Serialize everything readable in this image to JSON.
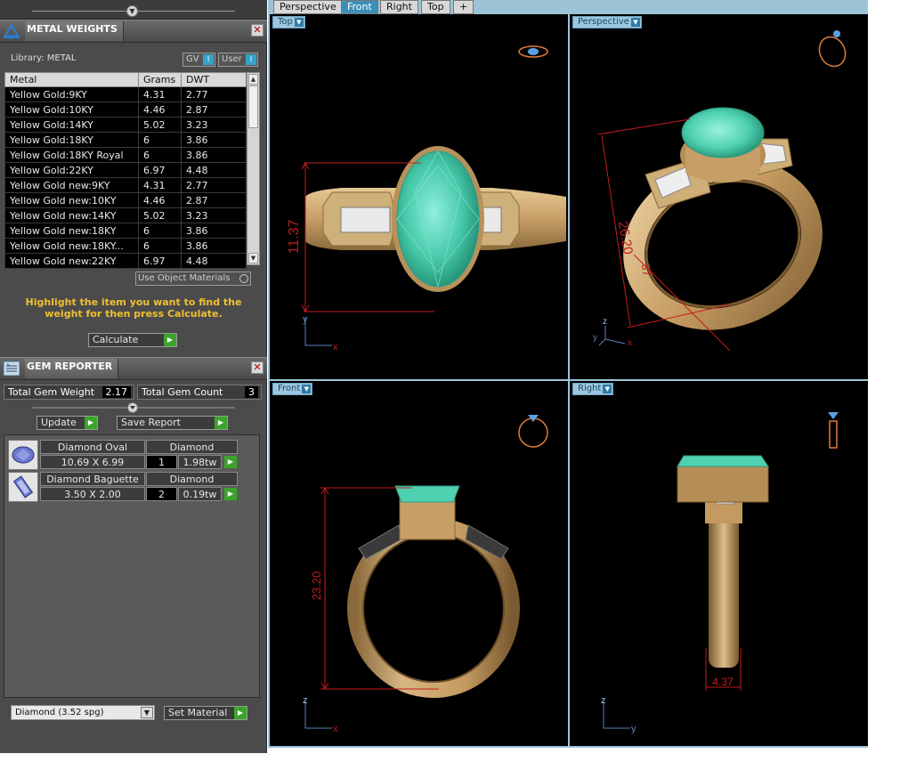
{
  "metal_weights": {
    "title": "METAL WEIGHTS",
    "library_label": "Library: METAL",
    "gv_button": "GV",
    "user_button": "User",
    "columns": [
      "Metal",
      "Grams",
      "DWT"
    ],
    "rows": [
      [
        "Yellow Gold:9KY",
        "4.31",
        "2.77"
      ],
      [
        "Yellow Gold:10KY",
        "4.46",
        "2.87"
      ],
      [
        "Yellow Gold:14KY",
        "5.02",
        "3.23"
      ],
      [
        "Yellow Gold:18KY",
        "6",
        "3.86"
      ],
      [
        "Yellow Gold:18KY Royal",
        "6",
        "3.86"
      ],
      [
        "Yellow Gold:22KY",
        "6.97",
        "4.48"
      ],
      [
        "Yellow Gold new:9KY",
        "4.31",
        "2.77"
      ],
      [
        "Yellow Gold new:10KY",
        "4.46",
        "2.87"
      ],
      [
        "Yellow Gold new:14KY",
        "5.02",
        "3.23"
      ],
      [
        "Yellow Gold new:18KY",
        "6",
        "3.86"
      ],
      [
        "Yellow Gold new:18KY...",
        "6",
        "3.86"
      ],
      [
        "Yellow Gold new:22KY",
        "6.97",
        "4.48"
      ]
    ],
    "use_object_materials": "Use Object Materials",
    "hint": "Highlight the item you want to find the weight for then press Calculate.",
    "calculate_button": "Calculate"
  },
  "gem_reporter": {
    "title": "GEM REPORTER",
    "total_weight_label": "Total Gem Weight",
    "total_weight_value": "2.17",
    "total_count_label": "Total Gem Count",
    "total_count_value": "3",
    "update_button": "Update",
    "save_report_button": "Save Report",
    "gems": [
      {
        "name": "Diamond Oval",
        "size": "10.69 X 6.99",
        "material": "Diamond",
        "count": "1",
        "weight": "1.98tw"
      },
      {
        "name": "Diamond Baguette",
        "size": "3.50 X 2.00",
        "material": "Diamond",
        "count": "2",
        "weight": "0.19tw"
      }
    ],
    "material_select": "Diamond     (3.52 spg)",
    "set_material_button": "Set Material"
  },
  "tabs": [
    "Perspective",
    "Front",
    "Right",
    "Top",
    "+"
  ],
  "views": {
    "top": {
      "label": "Top",
      "dimension": "11.37",
      "axis_v": "y",
      "axis_h": "x"
    },
    "perspective": {
      "label": "Perspective",
      "dimension": "26.20",
      "dimension2": "37",
      "axis_v": "z",
      "axis_y": "y",
      "axis_x": "x"
    },
    "front": {
      "label": "Front",
      "dimension": "23.20",
      "axis_v": "z",
      "axis_h": "x"
    },
    "right": {
      "label": "Right",
      "dimension": "4.37",
      "axis_v": "z",
      "axis_h": "y"
    }
  },
  "colors": {
    "panel": "#4b4b4b",
    "accent_blue": "#3d8fb9",
    "green": "#3aa629",
    "hint_yellow": "#f0c030",
    "gold": "#c9a470",
    "emerald": "#5fd6bd",
    "dim_red": "#c21d1d"
  }
}
